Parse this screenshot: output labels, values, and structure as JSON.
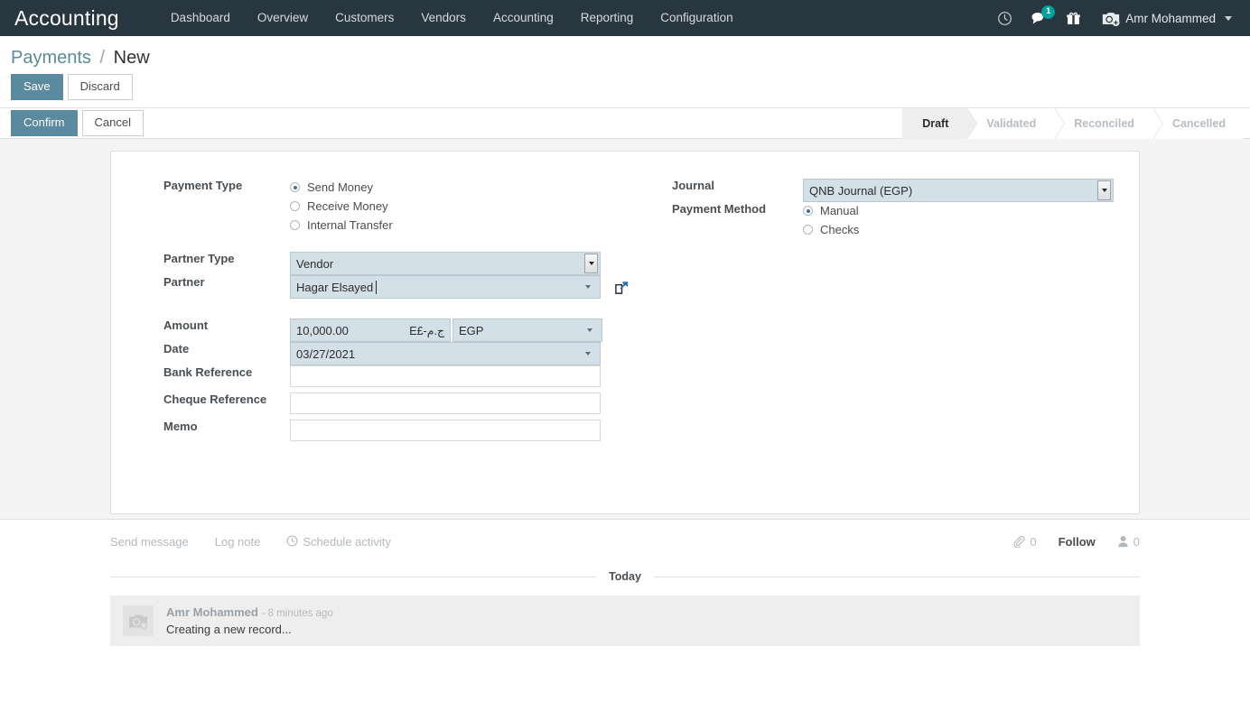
{
  "navbar": {
    "brand": "Accounting",
    "menu": [
      {
        "label": "Dashboard"
      },
      {
        "label": "Overview"
      },
      {
        "label": "Customers"
      },
      {
        "label": "Vendors"
      },
      {
        "label": "Accounting"
      },
      {
        "label": "Reporting"
      },
      {
        "label": "Configuration"
      }
    ],
    "icons": {
      "activity": "clock-icon",
      "messages": "chat-bubble-icon",
      "messages_badge": "1",
      "gift": "gift-icon",
      "avatar": "camera-avatar-icon"
    },
    "user_name": "Amr Mohammed",
    "background_color": "#28363f",
    "badge_color": "#00A09D"
  },
  "breadcrumb": {
    "root": "Payments",
    "separator": "/",
    "current": "New"
  },
  "control_panel": {
    "save_label": "Save",
    "discard_label": "Discard",
    "confirm_label": "Confirm",
    "cancel_label": "Cancel",
    "primary_color": "#5b899e"
  },
  "statusbar": {
    "steps": [
      {
        "label": "Draft",
        "active": true
      },
      {
        "label": "Validated",
        "active": false
      },
      {
        "label": "Reconciled",
        "active": false
      },
      {
        "label": "Cancelled",
        "active": false
      }
    ]
  },
  "form": {
    "left": {
      "payment_type_label": "Payment Type",
      "payment_type_options": [
        {
          "label": "Send Money",
          "selected": true
        },
        {
          "label": "Receive Money",
          "selected": false
        },
        {
          "label": "Internal Transfer",
          "selected": false
        }
      ],
      "partner_type_label": "Partner Type",
      "partner_type_value": "Vendor",
      "partner_label": "Partner",
      "partner_value": "Hagar Elsayed",
      "amount_label": "Amount",
      "amount_value": "10,000.00",
      "amount_symbol": "E£-ج.م",
      "currency_value": "EGP",
      "date_label": "Date",
      "date_value": "03/27/2021",
      "bank_reference_label": "Bank Reference",
      "bank_reference_value": "",
      "cheque_reference_label": "Cheque Reference",
      "cheque_reference_value": "",
      "memo_label": "Memo",
      "memo_value": ""
    },
    "right": {
      "journal_label": "Journal",
      "journal_value": "QNB Journal (EGP)",
      "payment_method_label": "Payment Method",
      "payment_method_options": [
        {
          "label": "Manual",
          "selected": true
        },
        {
          "label": "Checks",
          "selected": false
        }
      ]
    },
    "field_background": "#d4e0e7",
    "external_link_icon": "external-link-icon"
  },
  "chatter": {
    "send_message_label": "Send message",
    "log_note_label": "Log note",
    "schedule_activity_label": "Schedule activity",
    "attachment_count": "0",
    "follow_label": "Follow",
    "follower_count": "0",
    "date_separator": "Today",
    "messages": [
      {
        "author": "Amr Mohammed",
        "time": "- 8 minutes ago",
        "body": "Creating a new record..."
      }
    ]
  }
}
